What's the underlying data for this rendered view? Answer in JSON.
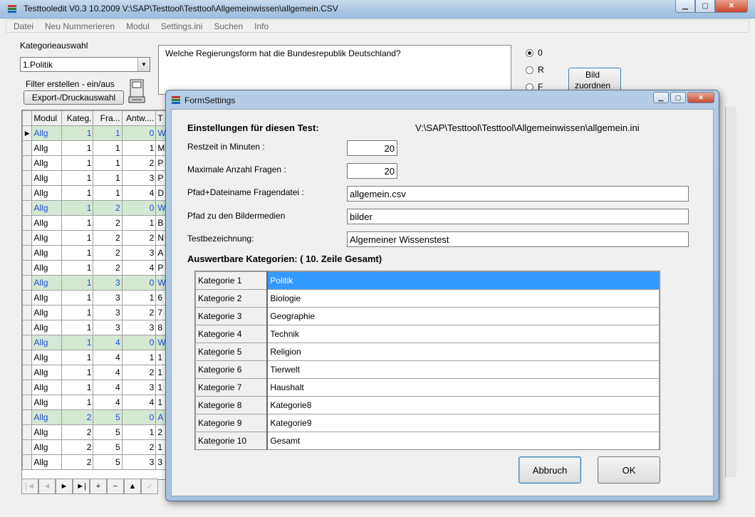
{
  "window": {
    "title": "Testtooledit V0.3 10.2009 V:\\SAP\\Testtool\\Testtool\\Allgemeinwissen\\allgemein.CSV"
  },
  "menu": [
    "Datei",
    "Neu Nummerieren",
    "Modul",
    "Settings.ini",
    "Suchen",
    "Info"
  ],
  "main": {
    "kategorie_label": "Kategorieauswahl",
    "kategorie_value": "1.Politik",
    "filter_label": "Filter erstellen - ein/aus",
    "export_button": "Export-/Druckauswahl",
    "question": "Welche Regierungsform hat die Bundesrepublik Deutschland?",
    "radio": [
      {
        "label": "0",
        "checked": true
      },
      {
        "label": "R",
        "checked": false
      },
      {
        "label": "F",
        "checked": false
      }
    ],
    "bild_button": "Bild zuordnen",
    "grid": {
      "headers": [
        "Modul",
        "Kateg.",
        "Fra...",
        "Antw....",
        "T"
      ],
      "rows": [
        {
          "modul": "Allg",
          "kat": "1",
          "fra": "1",
          "antw": "0",
          "t": "W",
          "hl": true,
          "current": true
        },
        {
          "modul": "Allg",
          "kat": "1",
          "fra": "1",
          "antw": "1",
          "t": "M"
        },
        {
          "modul": "Allg",
          "kat": "1",
          "fra": "1",
          "antw": "2",
          "t": "P"
        },
        {
          "modul": "Allg",
          "kat": "1",
          "fra": "1",
          "antw": "3",
          "t": "P"
        },
        {
          "modul": "Allg",
          "kat": "1",
          "fra": "1",
          "antw": "4",
          "t": "D"
        },
        {
          "modul": "Allg",
          "kat": "1",
          "fra": "2",
          "antw": "0",
          "t": "W",
          "hl": true
        },
        {
          "modul": "Allg",
          "kat": "1",
          "fra": "2",
          "antw": "1",
          "t": "B"
        },
        {
          "modul": "Allg",
          "kat": "1",
          "fra": "2",
          "antw": "2",
          "t": "N"
        },
        {
          "modul": "Allg",
          "kat": "1",
          "fra": "2",
          "antw": "3",
          "t": "A"
        },
        {
          "modul": "Allg",
          "kat": "1",
          "fra": "2",
          "antw": "4",
          "t": "P"
        },
        {
          "modul": "Allg",
          "kat": "1",
          "fra": "3",
          "antw": "0",
          "t": "W",
          "hl": true
        },
        {
          "modul": "Allg",
          "kat": "1",
          "fra": "3",
          "antw": "1",
          "t": "6"
        },
        {
          "modul": "Allg",
          "kat": "1",
          "fra": "3",
          "antw": "2",
          "t": "7"
        },
        {
          "modul": "Allg",
          "kat": "1",
          "fra": "3",
          "antw": "3",
          "t": "8"
        },
        {
          "modul": "Allg",
          "kat": "1",
          "fra": "4",
          "antw": "0",
          "t": "W",
          "hl": true
        },
        {
          "modul": "Allg",
          "kat": "1",
          "fra": "4",
          "antw": "1",
          "t": "1"
        },
        {
          "modul": "Allg",
          "kat": "1",
          "fra": "4",
          "antw": "2",
          "t": "1"
        },
        {
          "modul": "Allg",
          "kat": "1",
          "fra": "4",
          "antw": "3",
          "t": "1"
        },
        {
          "modul": "Allg",
          "kat": "1",
          "fra": "4",
          "antw": "4",
          "t": "1"
        },
        {
          "modul": "Allg",
          "kat": "2",
          "fra": "5",
          "antw": "0",
          "t": "A",
          "hl": true
        },
        {
          "modul": "Allg",
          "kat": "2",
          "fra": "5",
          "antw": "1",
          "t": "2"
        },
        {
          "modul": "Allg",
          "kat": "2",
          "fra": "5",
          "antw": "2",
          "t": "1"
        },
        {
          "modul": "Allg",
          "kat": "2",
          "fra": "5",
          "antw": "3",
          "t": "3"
        }
      ]
    },
    "navigator": [
      "|◄",
      "◄",
      "►",
      "►|",
      "+",
      "−",
      "▲",
      "✓"
    ]
  },
  "dialog": {
    "title": "FormSettings",
    "heading": "Einstellungen für diesen Test:",
    "ini_path": "V:\\SAP\\Testtool\\Testtool\\Allgemeinwissen\\allgemein.ini",
    "restzeit_label": "Restzeit in Minuten :",
    "restzeit_value": "20",
    "max_fragen_label": "Maximale Anzahl Fragen :",
    "max_fragen_value": "20",
    "pfad_datei_label": "Pfad+Dateiname Fragendatei :",
    "pfad_datei_value": "allgemein.csv",
    "pfad_bilder_label": "Pfad zu den Bildermedien",
    "pfad_bilder_value": "bilder",
    "testbez_label": "Testbezeichnung:",
    "testbez_value": "Algemeiner Wissenstest",
    "kategorien_heading": "Auswertbare Kategorien: ( 10. Zeile Gesamt)",
    "kategorien": [
      {
        "key": "Kategorie 1",
        "value": "Politik",
        "selected": true
      },
      {
        "key": "Kategorie 2",
        "value": "Biologie"
      },
      {
        "key": "Kategorie 3",
        "value": "Geographie"
      },
      {
        "key": "Kategorie 4",
        "value": "Technik"
      },
      {
        "key": "Kategorie 5",
        "value": "Religion"
      },
      {
        "key": "Kategorie 6",
        "value": "Tierwelt"
      },
      {
        "key": "Kategorie 7",
        "value": "Haushalt"
      },
      {
        "key": "Kategorie 8",
        "value": "Kategorie8"
      },
      {
        "key": "Kategorie 9",
        "value": "Kategorie9"
      },
      {
        "key": "Kategorie 10",
        "value": "Gesamt"
      }
    ],
    "abbruch": "Abbruch",
    "ok": "OK"
  }
}
